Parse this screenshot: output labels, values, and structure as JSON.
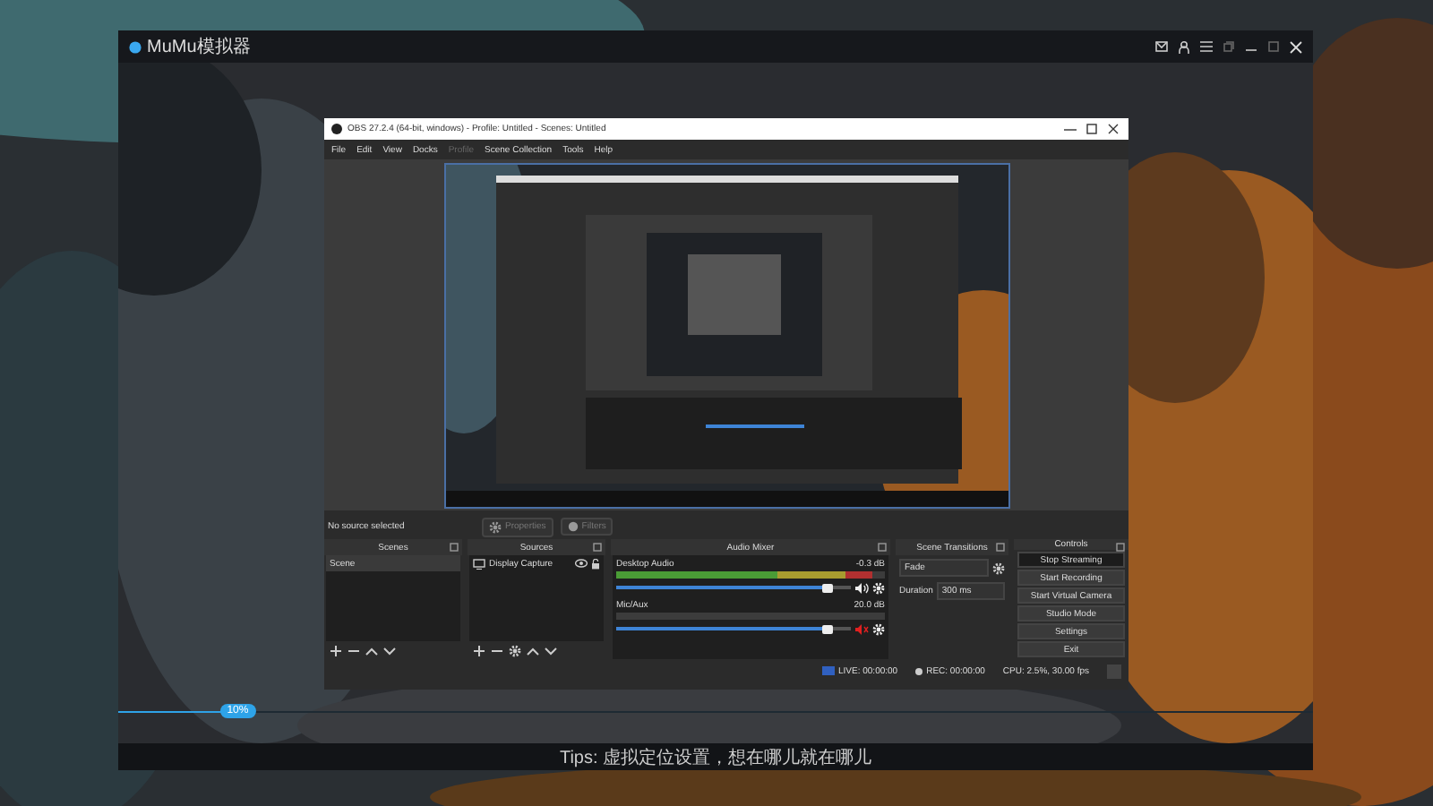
{
  "emulator": {
    "title": "MuMu模拟器",
    "progress": {
      "level": 0.1,
      "label": "10%"
    },
    "tips": "Tips: 虚拟定位设置，想在哪儿就在哪儿"
  },
  "obs": {
    "title": "OBS 27.2.4 (64-bit, windows) - Profile: Untitled - Scenes: Untitled",
    "menu": [
      {
        "label": "File",
        "disabled": false
      },
      {
        "label": "Edit",
        "disabled": false
      },
      {
        "label": "View",
        "disabled": false
      },
      {
        "label": "Docks",
        "disabled": false
      },
      {
        "label": "Profile",
        "disabled": true
      },
      {
        "label": "Scene Collection",
        "disabled": false
      },
      {
        "label": "Tools",
        "disabled": false
      },
      {
        "label": "Help",
        "disabled": false
      }
    ],
    "source_bar": {
      "text": "No source selected",
      "buttons": [
        {
          "label": "Properties",
          "disabled": true
        },
        {
          "label": "Filters",
          "disabled": true
        }
      ]
    },
    "scenes": {
      "title": "Scenes",
      "items": [
        {
          "label": "Scene",
          "selected": true
        }
      ]
    },
    "sources": {
      "title": "Sources",
      "items": [
        {
          "label": "Display Capture",
          "visible": true,
          "locked": false
        }
      ]
    },
    "audio_mixer": {
      "title": "Audio Mixer",
      "channels": [
        {
          "name": "Desktop Audio",
          "reading": "-0.3 dB",
          "active": true,
          "muted": false,
          "level": 0.9
        },
        {
          "name": "Mic/Aux",
          "reading": "20.0 dB",
          "active": false,
          "muted": true,
          "level": 0.9
        }
      ]
    },
    "transitions": {
      "title": "Scene Transitions",
      "transition": "Fade",
      "duration_label": "Duration",
      "duration": "300 ms"
    },
    "controls": {
      "title": "Controls",
      "buttons": [
        {
          "label": "Stop Streaming",
          "active": true
        },
        {
          "label": "Start Recording",
          "active": false
        },
        {
          "label": "Start Virtual Camera",
          "active": false
        },
        {
          "label": "Studio Mode",
          "active": false
        },
        {
          "label": "Settings",
          "active": false
        },
        {
          "label": "Exit",
          "active": false
        }
      ]
    },
    "status_bar": {
      "live": "LIVE: 00:00:00",
      "rec": "REC: 00:00:00",
      "cpu": "CPU: 2.5%, 30.00 fps"
    }
  }
}
